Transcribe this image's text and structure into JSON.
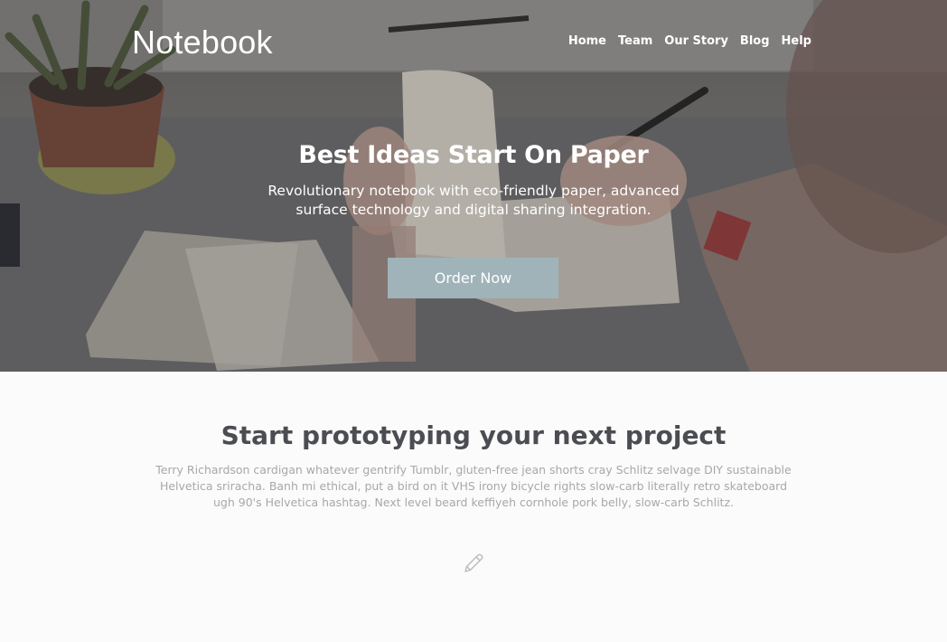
{
  "nav": {
    "logo": "Notebook",
    "links": [
      "Home",
      "Team",
      "Our Story",
      "Blog",
      "Help"
    ]
  },
  "hero": {
    "title": "Best Ideas Start On Paper",
    "subtitle": "Revolutionary notebook with eco-friendly paper, advanced surface technology and digital sharing integration.",
    "button_label": "Order Now"
  },
  "section": {
    "title": "Start prototyping your next project",
    "text": "Terry Richardson cardigan whatever gentrify Tumblr, gluten-free jean shorts cray Schlitz selvage DIY sustainable Helvetica sriracha. Banh mi ethical, put a bird on it VHS irony bicycle rights slow-carb literally retro skateboard ugh 90's Helvetica hashtag. Next level beard keffiyeh cornhole pork belly, slow-carb Schlitz."
  },
  "icons": {
    "section_icon": "pencil-icon"
  },
  "colors": {
    "button": "#9fb3b9",
    "section_background": "#fbfbfb",
    "section_title": "#4b4d52",
    "section_text": "#a8a8a8"
  }
}
